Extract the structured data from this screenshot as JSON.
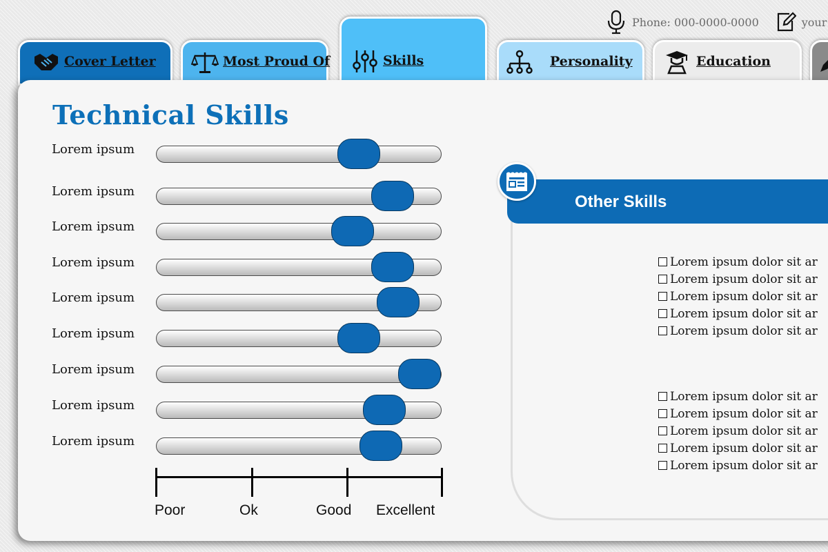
{
  "header": {
    "phone": "Phone: 000-0000-0000",
    "email": "your"
  },
  "tabs": [
    {
      "id": "cover",
      "label": "Cover Letter",
      "icon": "handshake-icon"
    },
    {
      "id": "proud",
      "label": "Most Proud Of",
      "icon": "scales-icon"
    },
    {
      "id": "skills",
      "label": "Skills",
      "icon": "sliders-icon",
      "active": true
    },
    {
      "id": "personality",
      "label": "Personality",
      "icon": "org-chart-icon"
    },
    {
      "id": "education",
      "label": "Education",
      "icon": "graduate-icon"
    },
    {
      "id": "more",
      "label": "",
      "icon": "pen-icon"
    }
  ],
  "technical": {
    "title": "Technical Skills",
    "skills": [
      {
        "label": "Lorem ipsum",
        "level": 0.71
      },
      {
        "label": "Lorem ipsum",
        "level": 0.83
      },
      {
        "label": "Lorem ipsum",
        "level": 0.69
      },
      {
        "label": "Lorem ipsum",
        "level": 0.83
      },
      {
        "label": "Lorem ipsum",
        "level": 0.85
      },
      {
        "label": "Lorem ipsum",
        "level": 0.71
      },
      {
        "label": "Lorem ipsum",
        "level": 0.925
      },
      {
        "label": "Lorem ipsum",
        "level": 0.8
      },
      {
        "label": "Lorem ipsum",
        "level": 0.79
      }
    ],
    "scale": [
      "Poor",
      "Ok",
      "Good",
      "Excellent"
    ]
  },
  "other": {
    "title": "Other Skills",
    "group1": [
      "Lorem ipsum dolor sit ar",
      "Lorem ipsum dolor sit ar",
      "Lorem ipsum dolor sit ar",
      "Lorem ipsum dolor sit ar",
      "Lorem ipsum dolor sit ar"
    ],
    "group2": [
      "Lorem ipsum dolor sit ar",
      "Lorem ipsum dolor sit ar",
      "Lorem ipsum dolor sit ar",
      "Lorem ipsum dolor sit ar",
      "Lorem ipsum dolor sit ar"
    ]
  },
  "colors": {
    "accent": "#0d70b8",
    "knob": "#0e69b4",
    "tab_cover": "#0f6fb8",
    "tab_proud": "#4db4ee",
    "tab_skills": "#4fbff8",
    "tab_personality": "#a9dcfa",
    "tab_education": "#ececec"
  }
}
